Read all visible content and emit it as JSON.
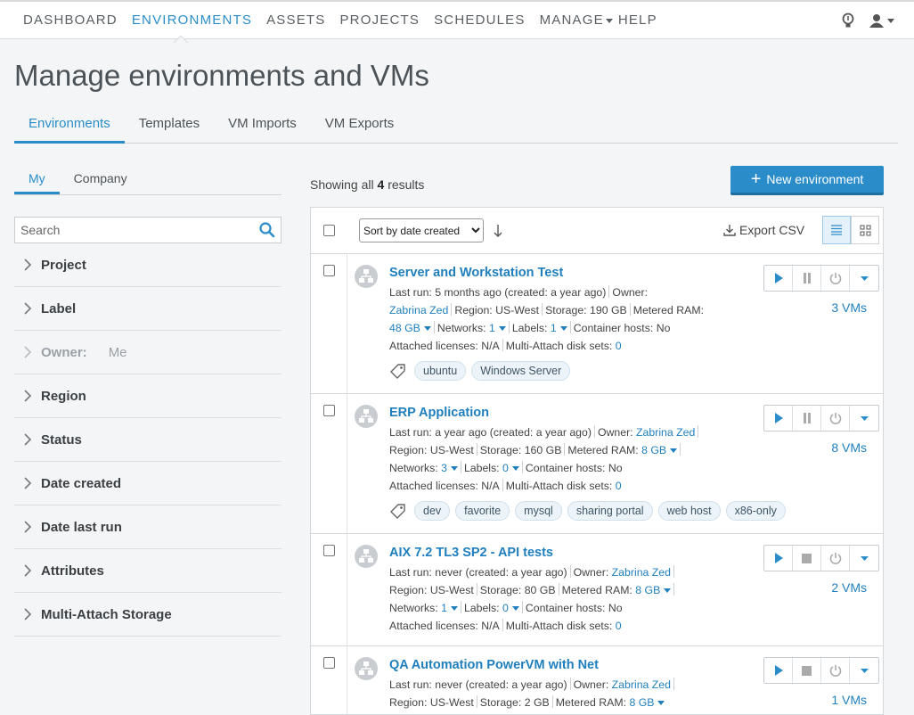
{
  "nav": {
    "items": [
      "DASHBOARD",
      "ENVIRONMENTS",
      "ASSETS",
      "PROJECTS",
      "SCHEDULES",
      "MANAGE",
      "HELP"
    ],
    "active_index": 1
  },
  "page": {
    "title": "Manage environments and VMs"
  },
  "tabs": [
    "Environments",
    "Templates",
    "VM Imports",
    "VM Exports"
  ],
  "sidebar": {
    "subtabs": [
      "My",
      "Company"
    ],
    "search_placeholder": "Search",
    "filters": {
      "project": "Project",
      "label": "Label",
      "owner": "Owner:",
      "owner_value": "Me",
      "region": "Region",
      "status": "Status",
      "date_created": "Date created",
      "date_last_run": "Date last run",
      "attributes": "Attributes",
      "multi_attach": "Multi-Attach Storage"
    }
  },
  "results": {
    "prefix": "Showing all",
    "count": "4",
    "suffix": "results"
  },
  "toolbar": {
    "new_label": "New environment",
    "sort_label": "Sort by date created",
    "export_label": "Export CSV"
  },
  "labels": {
    "last_run": "Last run:",
    "owner": "Owner:",
    "region": "Region:",
    "storage": "Storage:",
    "metered_ram": "Metered RAM:",
    "networks": "Networks:",
    "labels": "Labels:",
    "container_hosts": "Container hosts:",
    "attached_licenses": "Attached licenses:",
    "multi_attach": "Multi-Attach disk sets:"
  },
  "environments": [
    {
      "name": "Server and Workstation Test",
      "last_run": "5 months ago (created: a year ago)",
      "owner": "Zabrina Zed",
      "region": "US-West",
      "storage": "190 GB",
      "ram": "48 GB",
      "networks": "1",
      "labels": "1",
      "container_hosts": "No",
      "licenses": "N/A",
      "disk_sets": "0",
      "tags": [
        "ubuntu",
        "Windows Server"
      ],
      "vms": "3 VMs"
    },
    {
      "name": "ERP Application",
      "last_run": "a year ago (created: a year ago)",
      "owner": "Zabrina Zed",
      "region": "US-West",
      "storage": "160 GB",
      "ram": "8 GB",
      "networks": "3",
      "labels": "0",
      "container_hosts": "No",
      "licenses": "N/A",
      "disk_sets": "0",
      "tags": [
        "dev",
        "favorite",
        "mysql",
        "sharing portal",
        "web host",
        "x86-only"
      ],
      "vms": "8 VMs"
    },
    {
      "name": "AIX 7.2 TL3 SP2 - API tests",
      "last_run": "never (created: a year ago)",
      "owner": "Zabrina Zed",
      "region": "US-West",
      "storage": "80 GB",
      "ram": "8 GB",
      "networks": "1",
      "labels": "0",
      "container_hosts": "No",
      "licenses": "N/A",
      "disk_sets": "0",
      "vms": "2 VMs"
    },
    {
      "name": "QA Automation PowerVM with Net",
      "last_run": "never (created: a year ago)",
      "owner": "Zabrina Zed",
      "region": "US-West",
      "storage": "2 GB",
      "ram": "8 GB",
      "vms": "1 VMs"
    }
  ],
  "colors": {
    "accent": "#2a8dc9",
    "link": "#1f7fbd"
  }
}
